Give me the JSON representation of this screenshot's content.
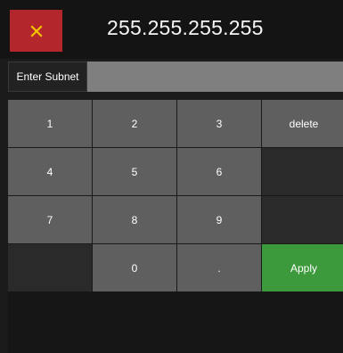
{
  "header": {
    "title": "255.255.255.255",
    "close_icon": "close-x-icon",
    "close_color": "#b3262b",
    "icon_color": "#f2c200"
  },
  "subnet": {
    "label": "Enter Subnet",
    "value": "",
    "placeholder": ""
  },
  "keypad": {
    "keys": [
      "1",
      "2",
      "3",
      "delete",
      "4",
      "5",
      "6",
      "",
      "7",
      "8",
      "9",
      "",
      "",
      "0",
      ".",
      "Apply"
    ],
    "apply_color": "#3c9a3c"
  }
}
